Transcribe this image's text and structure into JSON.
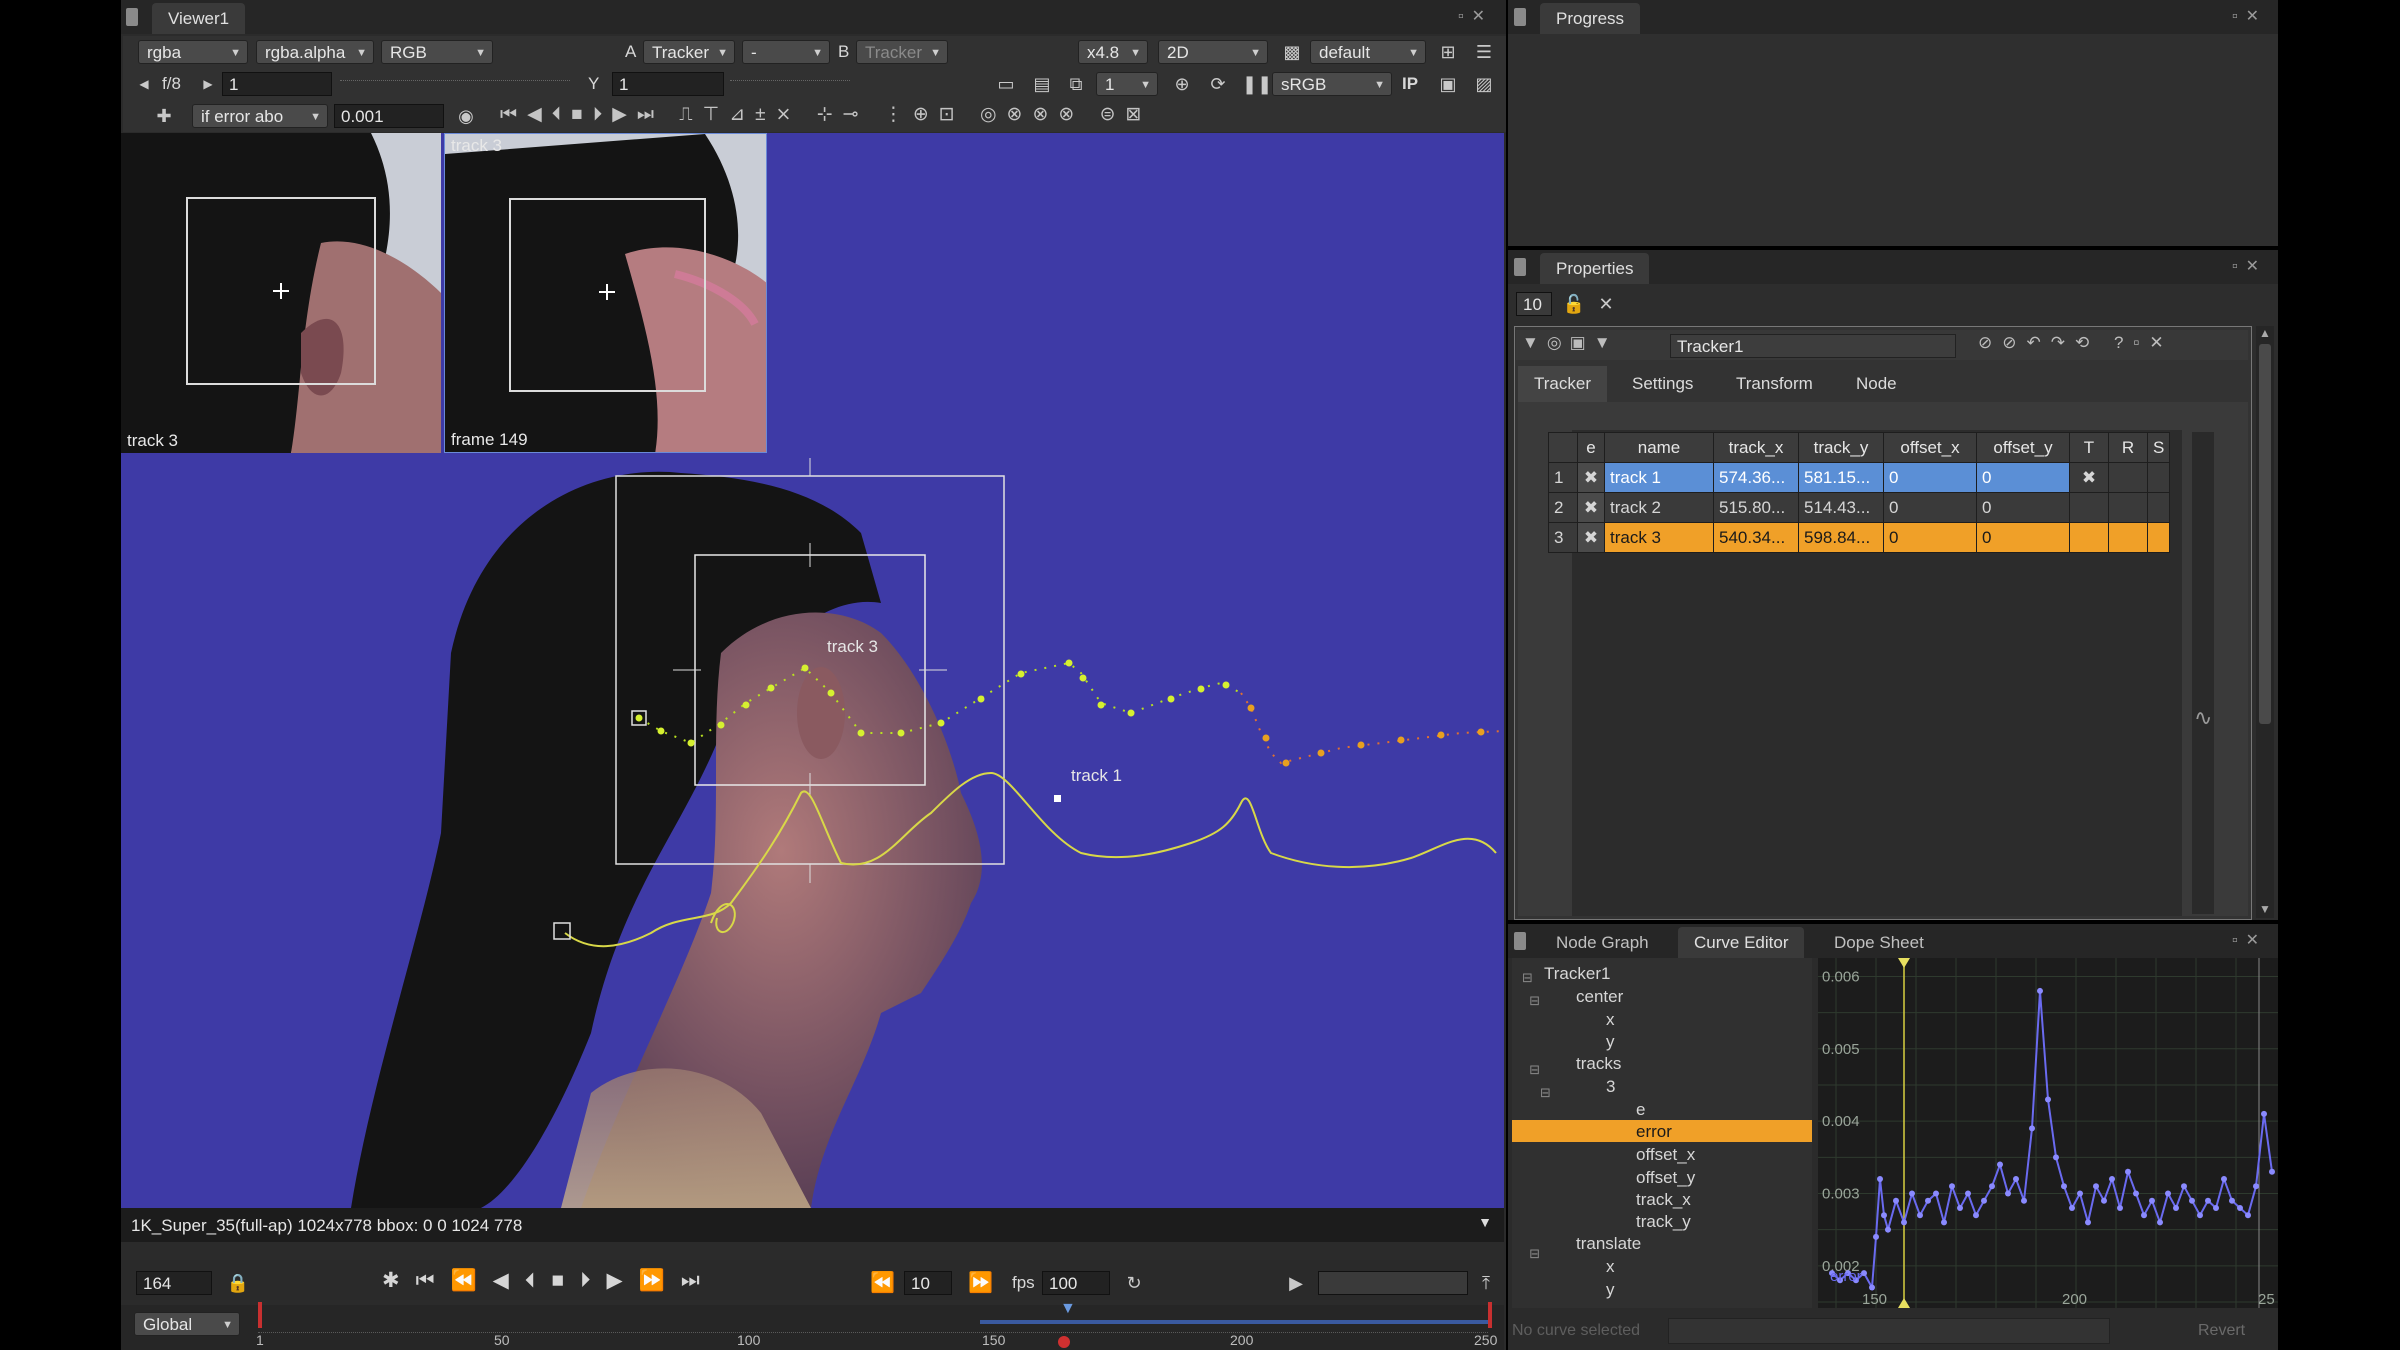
{
  "viewer": {
    "tab_title": "Viewer1",
    "channels": "rgba",
    "alpha_channel": "rgba.alpha",
    "display_channels": "RGB",
    "input_a_label": "A",
    "input_a": "Tracker",
    "composite": "-",
    "input_b_label": "B",
    "input_b": "Tracker",
    "zoom": "x4.8",
    "view_mode": "2D",
    "lut_lookup": "default",
    "fstop": "f/8",
    "gain": "1",
    "gamma_label": "Y",
    "gamma": "1",
    "proxy": "1",
    "colorspace": "sRGB",
    "ip_label": "IP",
    "error_mode": "if error abo",
    "error_threshold": "0.001",
    "status_text": "1K_Super_35(full-ap) 1024x778 bbox: 0 0 1024 778",
    "inset1_label_top": "",
    "inset1_label_bottom": "track 3",
    "inset2_label_top": "track 3",
    "inset2_label_bottom": "frame 149",
    "overlay_track3": "track 3",
    "overlay_track1": "track 1"
  },
  "timeline": {
    "current_frame": "164",
    "skip_frames": "10",
    "fps_label": "fps",
    "fps": "100",
    "range_mode": "Global",
    "ticks": [
      "1",
      "50",
      "100",
      "150",
      "200",
      "250"
    ]
  },
  "progress": {
    "tab_title": "Progress"
  },
  "properties": {
    "tab_title": "Properties",
    "max_panels": "10",
    "node_name": "Tracker1",
    "tabs": [
      "Tracker",
      "Settings",
      "Transform",
      "Node"
    ],
    "columns": [
      "e",
      "name",
      "track_x",
      "track_y",
      "offset_x",
      "offset_y",
      "T",
      "R",
      "S"
    ],
    "rows": [
      {
        "index": "1",
        "name": "track 1",
        "track_x": "574.36...",
        "track_y": "581.15...",
        "offset_x": "0",
        "offset_y": "0"
      },
      {
        "index": "2",
        "name": "track 2",
        "track_x": "515.80...",
        "track_y": "514.43...",
        "offset_x": "0",
        "offset_y": "0"
      },
      {
        "index": "3",
        "name": "track 3",
        "track_x": "540.34...",
        "track_y": "598.84...",
        "offset_x": "0",
        "offset_y": "0"
      }
    ]
  },
  "curve_editor": {
    "tabs": [
      "Node Graph",
      "Curve Editor",
      "Dope Sheet"
    ],
    "tree": {
      "root": "Tracker1",
      "center": "center",
      "center_x": "x",
      "center_y": "y",
      "tracks": "tracks",
      "track_num": "3",
      "e": "e",
      "error": "error",
      "offset_x": "offset_x",
      "offset_y": "offset_y",
      "track_x": "track_x",
      "track_y": "track_y",
      "translate": "translate",
      "translate_x": "x",
      "translate_y": "y"
    },
    "y_ticks": [
      "0.006",
      "0.005",
      "0.004",
      "0.003",
      "0.002"
    ],
    "x_ticks": [
      "150",
      "200",
      "25"
    ],
    "curve_label": "error",
    "footer_text": "No curve selected",
    "revert_label": "Revert"
  },
  "chart_data": {
    "type": "line",
    "title": "",
    "xlabel": "",
    "ylabel": "",
    "xlim": [
      138,
      249
    ],
    "ylim": [
      0.0015,
      0.0062
    ],
    "series": [
      {
        "name": "error",
        "x": [
          139,
          141,
          143,
          145,
          147,
          149,
          150,
          151,
          152,
          153,
          155,
          157,
          159,
          161,
          163,
          165,
          167,
          169,
          171,
          173,
          175,
          177,
          179,
          181,
          183,
          185,
          187,
          189,
          191,
          193,
          195,
          197,
          199,
          201,
          203,
          205,
          207,
          209,
          211,
          213,
          215,
          217,
          219,
          221,
          223,
          225,
          227,
          229,
          231,
          233,
          235,
          237,
          239,
          241,
          243,
          245,
          247,
          249
        ],
        "y": [
          0.0019,
          0.0018,
          0.0019,
          0.0018,
          0.0019,
          0.0017,
          0.0024,
          0.0032,
          0.0027,
          0.0025,
          0.0029,
          0.0026,
          0.003,
          0.0027,
          0.0029,
          0.003,
          0.0026,
          0.0031,
          0.0028,
          0.003,
          0.0027,
          0.0029,
          0.0031,
          0.0034,
          0.003,
          0.0032,
          0.0029,
          0.0039,
          0.0058,
          0.0043,
          0.0035,
          0.0031,
          0.0028,
          0.003,
          0.0026,
          0.0031,
          0.0029,
          0.0032,
          0.0028,
          0.0033,
          0.003,
          0.0027,
          0.0029,
          0.0026,
          0.003,
          0.0028,
          0.0031,
          0.0029,
          0.0027,
          0.0029,
          0.0028,
          0.0032,
          0.0029,
          0.0028,
          0.0027,
          0.0031,
          0.0041,
          0.0033
        ]
      }
    ]
  },
  "colors": {
    "accent_orange": "#f0a028",
    "selection_blue": "#5b8fd6",
    "viewer_background": "#3e3aa6",
    "curve_blue": "#6a6af0",
    "track_yellow_green": "#c8e020"
  },
  "icons": [
    "grip-icon",
    "float-icon",
    "close-icon",
    "play-icon",
    "stop-icon",
    "lock-icon",
    "loop-icon",
    "chevron-down-icon"
  ]
}
